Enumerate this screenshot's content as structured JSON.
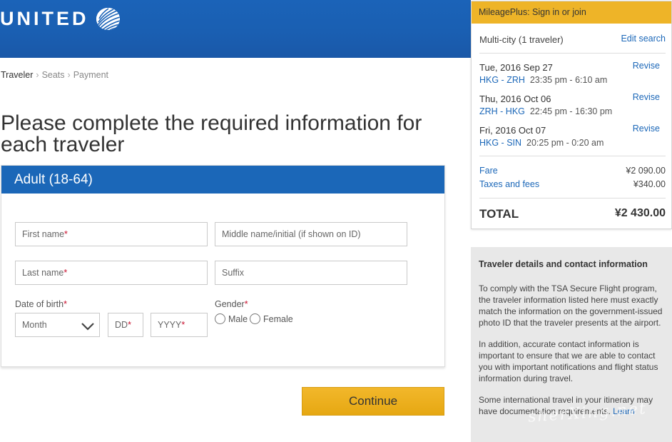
{
  "brand": {
    "name": "UNITED",
    "logo_icon": "united-globe-icon",
    "header_color": "#1b63b8"
  },
  "breadcrumb": {
    "items": [
      "Traveler",
      "Seats",
      "Payment"
    ],
    "separator": "›"
  },
  "heading": "Please complete the required information for each traveler",
  "form": {
    "section_title": "Adult (18-64)",
    "first_name": {
      "placeholder": "First name",
      "required": "*"
    },
    "middle_name": {
      "placeholder": "Middle name/initial (if shown on ID)"
    },
    "last_name": {
      "placeholder": "Last name",
      "required": "*"
    },
    "suffix": {
      "placeholder": "Suffix"
    },
    "dob": {
      "label": "Date of birth",
      "required": "*",
      "month_value": "Month",
      "day_placeholder": "DD",
      "day_required": "*",
      "year_placeholder": "YYYY",
      "year_required": "*"
    },
    "gender": {
      "label": "Gender",
      "required": "*",
      "options": [
        "Male",
        "Female"
      ]
    },
    "continue_label": "Continue"
  },
  "summary": {
    "mileageplus_link": "MileagePlus: Sign in or join",
    "trip_type": "Multi-city (1 traveler)",
    "edit_search": "Edit search",
    "segments": [
      {
        "date": "Tue, 2016 Sep 27",
        "route": "HKG - ZRH",
        "times": "23:35 pm - 6:10 am",
        "revise": "Revise"
      },
      {
        "date": "Thu, 2016 Oct 06",
        "route": "ZRH - HKG",
        "times": "22:45 pm - 16:30 pm",
        "revise": "Revise"
      },
      {
        "date": "Fri, 2016 Oct 07",
        "route": "HKG - SIN",
        "times": "20:25 pm - 0:20 am",
        "revise": "Revise"
      }
    ],
    "fare_label": "Fare",
    "fare_value": "¥2 090.00",
    "taxes_label": "Taxes and fees",
    "taxes_value": "¥340.00",
    "total_label": "TOTAL",
    "total_value": "¥2 430.00",
    "accent_color": "#eeb428"
  },
  "info": {
    "title": "Traveler details and contact information",
    "p1": "To comply with the TSA Secure Flight program, the traveler information listed here must exactly match the information on the government-issued photo ID that the traveler presents at the airport.",
    "p2": "In addition, accurate contact information is important to ensure that we are able to contact you with important notifications and flight status information during travel.",
    "p3_text": "Some international travel in your itinerary may have documentation requirements.",
    "p3_link": "Learn"
  },
  "watermark": "sherXing.net"
}
